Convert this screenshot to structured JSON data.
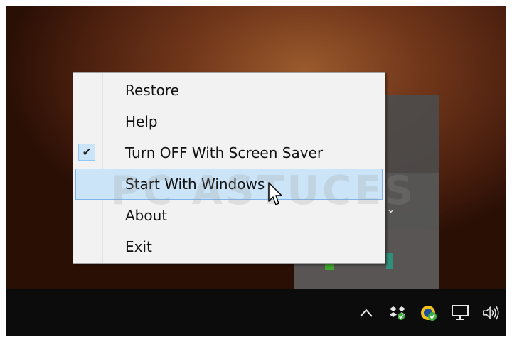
{
  "menu": {
    "items": [
      {
        "label": "Restore",
        "checked": false,
        "highlighted": false
      },
      {
        "label": "Help",
        "checked": false,
        "highlighted": false
      },
      {
        "label": "Turn OFF With Screen Saver",
        "checked": true,
        "highlighted": false
      },
      {
        "label": "Start With Windows",
        "checked": false,
        "highlighted": true
      },
      {
        "label": "About",
        "checked": false,
        "highlighted": false
      },
      {
        "label": "Exit",
        "checked": false,
        "highlighted": false
      }
    ],
    "check_glyph": "✔"
  },
  "watermark": {
    "text": "PC ASTUCES"
  },
  "tray": {
    "icons": [
      "chevron-up-icon",
      "dropbox-icon",
      "app-check-icon",
      "network-icon",
      "volume-icon"
    ]
  },
  "colors": {
    "menu_bg": "#f2f2f2",
    "highlight_bg": "#cce4f7",
    "highlight_border": "#7eb4ea",
    "taskbar_bg": "#0c0c0c"
  }
}
